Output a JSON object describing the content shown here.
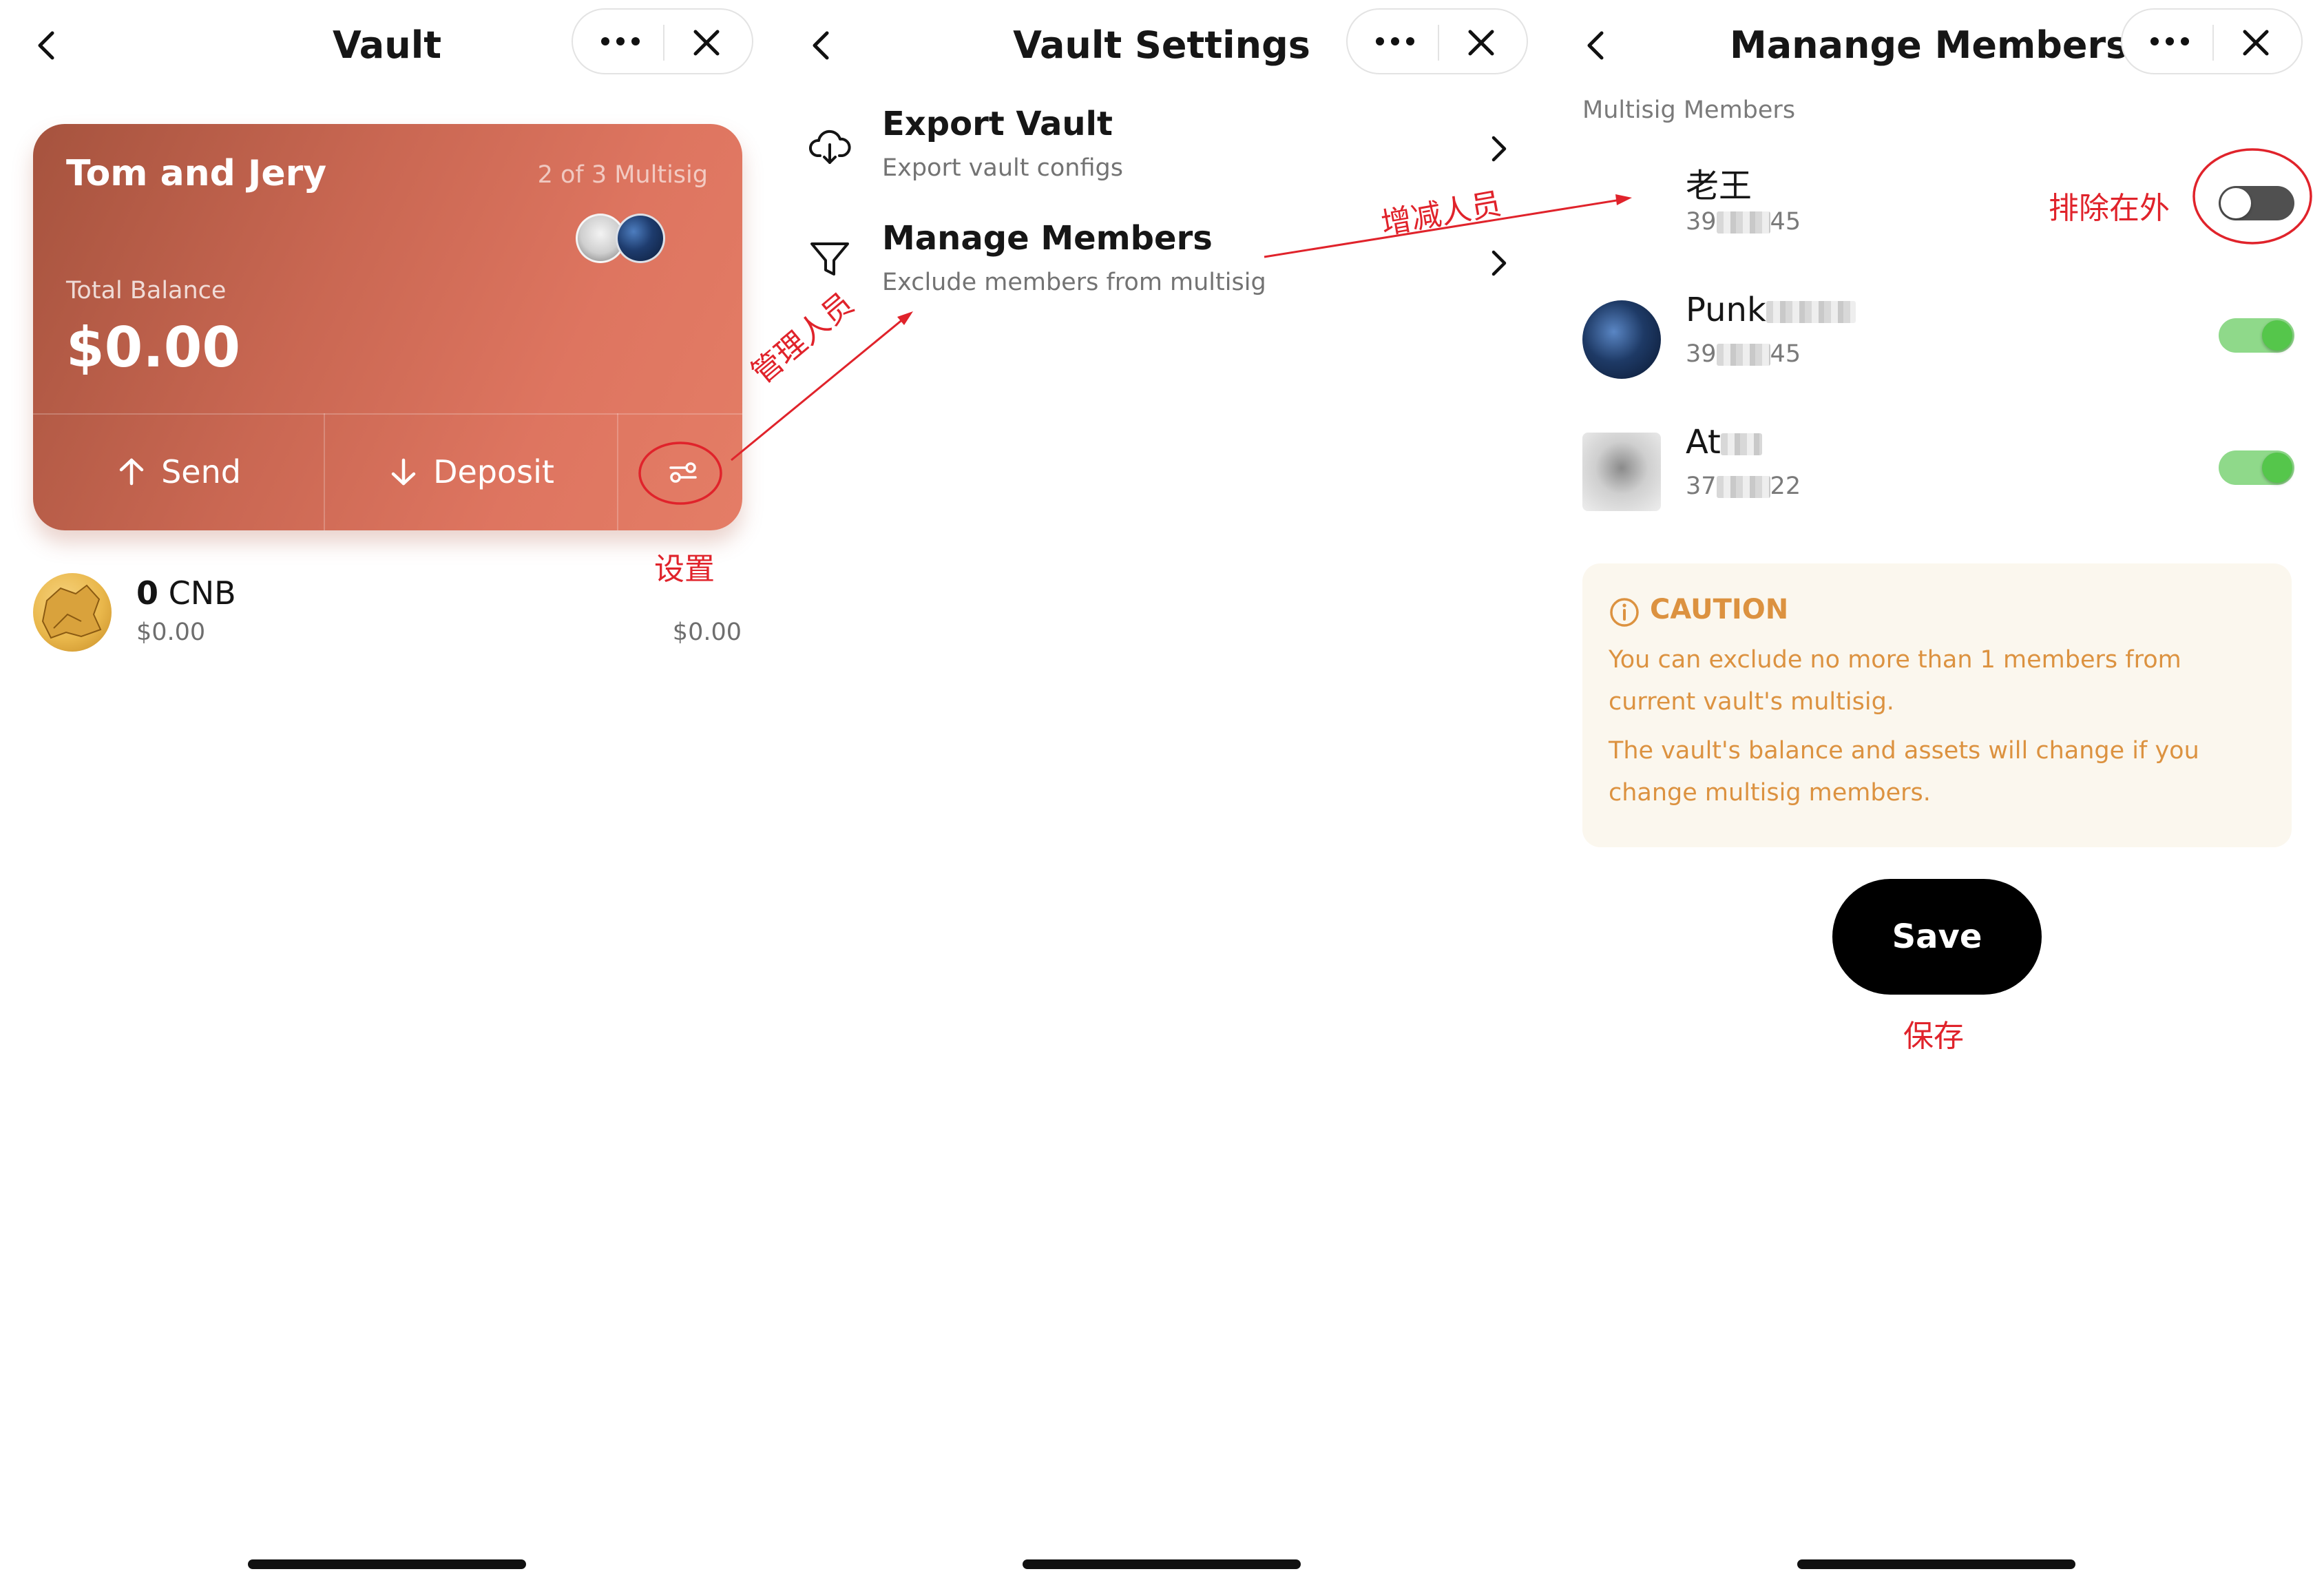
{
  "screens": {
    "vault": {
      "title": "Vault",
      "card": {
        "name": "Tom and Jery",
        "multisig": "2 of 3 Multisig",
        "balance_label": "Total Balance",
        "balance": "$0.00",
        "send_label": "Send",
        "deposit_label": "Deposit",
        "gradient_start": "#a6533e",
        "gradient_end": "#e47d66"
      },
      "token": {
        "amount": "0",
        "symbol": "CNB",
        "fiat": "$0.00",
        "value": "$0.00"
      }
    },
    "settings": {
      "title": "Vault Settings",
      "items": [
        {
          "title": "Export Vault",
          "subtitle": "Export vault configs",
          "icon": "cloud-download-icon"
        },
        {
          "title": "Manage Members",
          "subtitle": "Exclude members from multisig",
          "icon": "filter-icon"
        }
      ]
    },
    "members": {
      "title": "Manange Members",
      "section_label": "Multisig Members",
      "list": [
        {
          "name": "老王",
          "id_start": "39",
          "id_end": "45",
          "enabled": false
        },
        {
          "name": "Punk",
          "id_start": "39",
          "id_end": "45",
          "enabled": true
        },
        {
          "name": "At",
          "id_start": "37",
          "id_end": "22",
          "enabled": true
        }
      ],
      "caution": {
        "title": "CAUTION",
        "line1": "You can exclude no more than 1 members from current vault's multisig.",
        "line2": "The vault's balance and assets will change if you change multisig members."
      },
      "save_label": "Save",
      "toggle_on_color": "#55c64b",
      "caution_color": "#dc9240"
    }
  },
  "annotations": {
    "settings": "设置",
    "manage": "管理人员",
    "add_remove": "增减人员",
    "exclude": "排除在外",
    "save": "保存",
    "color": "#e0232b"
  }
}
